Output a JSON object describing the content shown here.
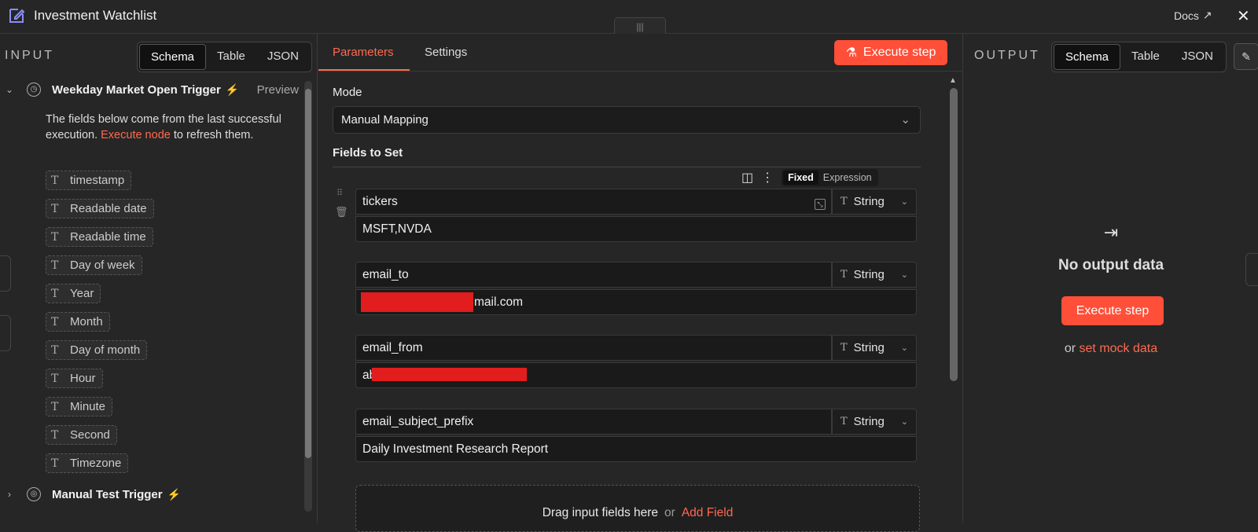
{
  "header": {
    "title": "Investment Watchlist",
    "docs_label": "Docs",
    "handle": "|||"
  },
  "input_panel": {
    "title": "INPUT",
    "view_tabs": [
      "Schema",
      "Table",
      "JSON"
    ],
    "trigger": {
      "name": "Weekday Market Open Trigger",
      "preview_label": "Preview"
    },
    "note_before": "The fields below come from the last successful execution.",
    "note_link": "Execute node",
    "note_after": "to refresh them.",
    "fields": [
      "timestamp",
      "Readable date",
      "Readable time",
      "Day of week",
      "Year",
      "Month",
      "Day of month",
      "Hour",
      "Minute",
      "Second",
      "Timezone"
    ],
    "second_trigger": "Manual Test Trigger"
  },
  "params_panel": {
    "tabs": [
      "Parameters",
      "Settings"
    ],
    "execute_label": "Execute step",
    "mode_label": "Mode",
    "mode_value": "Manual Mapping",
    "fields_label": "Fields to Set",
    "fixed_label": "Fixed",
    "expression_label": "Expression",
    "assignments": [
      {
        "name": "tickers",
        "type": "String",
        "value": "MSFT,NVDA"
      },
      {
        "name": "email_to",
        "type": "String",
        "value": "mail.com"
      },
      {
        "name": "email_from",
        "type": "String",
        "value": "ab"
      },
      {
        "name": "email_subject_prefix",
        "type": "String",
        "value": "Daily Investment Research Report"
      }
    ],
    "drop_text": "Drag input fields here",
    "drop_or": "or",
    "drop_link": "Add Field"
  },
  "output_panel": {
    "title": "OUTPUT",
    "view_tabs": [
      "Schema",
      "Table",
      "JSON"
    ],
    "empty_title": "No output data",
    "execute_label": "Execute step",
    "or_label": "or",
    "mock_link": "set mock data"
  },
  "colors": {
    "accent": "#ff4f38",
    "link": "#ff6a50",
    "redaction": "#e21d1d"
  }
}
